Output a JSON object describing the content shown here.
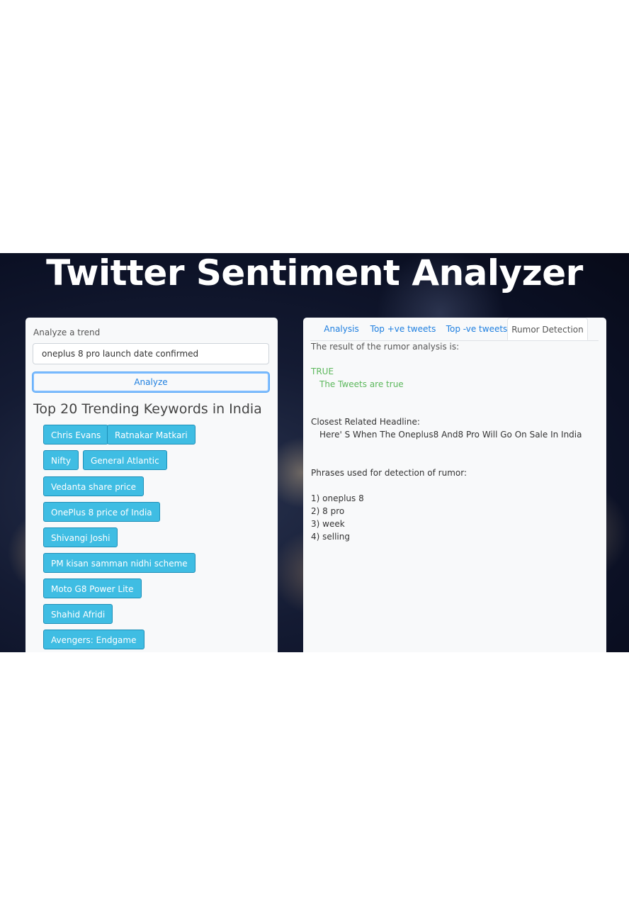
{
  "app": {
    "title": "Twitter Sentiment Analyzer"
  },
  "left": {
    "trend_label": "Analyze a trend",
    "trend_value": "oneplus 8 pro launch date confirmed",
    "analyze_label": "Analyze",
    "keywords_heading": "Top 20 Trending Keywords in India",
    "keywords": [
      "Chris Evans",
      "Ratnakar Matkari",
      "Nifty",
      "General Atlantic",
      "Vedanta share price",
      "OnePlus 8 price of India",
      "Shivangi Joshi",
      "PM kisan samman nidhi scheme",
      "Moto G8 Power Lite",
      "Shahid Afridi",
      "Avengers: Endgame"
    ]
  },
  "right": {
    "tabs": [
      {
        "label": "Analysis",
        "active": false
      },
      {
        "label": "Top +ve tweets",
        "active": false
      },
      {
        "label": "Top -ve tweets",
        "active": false
      },
      {
        "label": "Rumor Detection",
        "active": true
      }
    ],
    "result_intro": "The result of the rumor analysis is:",
    "result_value": "TRUE",
    "result_detail": "The Tweets are true",
    "headline_label": "Closest Related Headline:",
    "headline_text": "Here' S When The Oneplus8 And8 Pro Will Go On Sale In India",
    "phrases_label": "Phrases used for detection of rumor:",
    "phrases": [
      "1) oneplus 8",
      "2) 8 pro",
      "3) week",
      "4) selling"
    ]
  },
  "colors": {
    "keyword_button": "#3fbde3",
    "link_blue": "#1e7fe0",
    "true_green": "#5cb85c",
    "panel_bg": "#f8f9fa"
  }
}
